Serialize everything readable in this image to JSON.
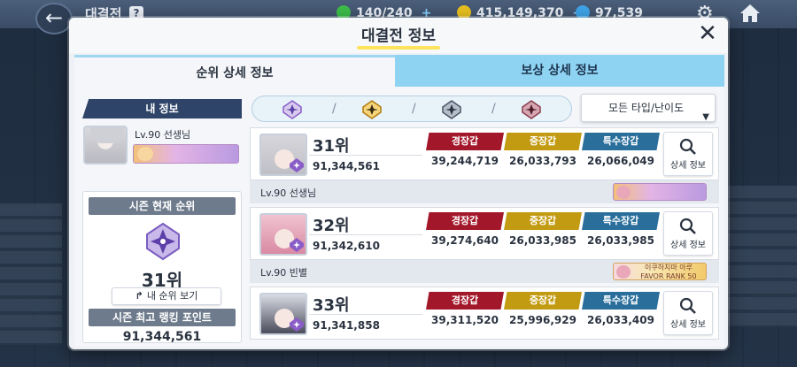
{
  "topbar": {
    "title": "대결전",
    "help": "?",
    "resources": [
      {
        "icon": "stamina-icon",
        "value": "140/240",
        "color": "#3dbd4a"
      },
      {
        "icon": "credit-icon",
        "value": "415,149,370",
        "color": "#e8c020"
      },
      {
        "icon": "pyroxene-icon",
        "value": "97,539",
        "color": "#3fa4e8"
      }
    ]
  },
  "modal": {
    "title": "대결전 정보",
    "tabs": [
      {
        "label": "순위 상세 정보",
        "active": true
      },
      {
        "label": "보상 상세 정보",
        "active": false
      }
    ]
  },
  "my_info": {
    "header": "내 정보",
    "level_name": "Lv.90 선생님",
    "season_rank_label": "시즌 현재 순위",
    "season_rank": "31위",
    "my_rank_button": "내 순위 보기",
    "best_points_label": "시즌 최고 랭킹 포인트",
    "best_points": "91,344,561"
  },
  "filters": {
    "types": [
      {
        "icon": "purple-emblem-icon",
        "color": "#8a5cc7"
      },
      {
        "icon": "gold-emblem-icon",
        "color": "#d8a01a"
      },
      {
        "icon": "gray-emblem-icon",
        "color": "#4a5564"
      },
      {
        "icon": "maroon-emblem-icon",
        "color": "#8a3a4a"
      }
    ],
    "dropdown_label": "모든 타입/난이도"
  },
  "stat_labels": {
    "light": "경장갑",
    "heavy": "중장갑",
    "special": "특수장갑"
  },
  "detail_label": "상세 정보",
  "rankings": [
    {
      "rank": "31위",
      "points": "91,344,561",
      "light": "39,244,719",
      "heavy": "26,033,793",
      "special": "26,066,049",
      "name": "Lv.90  선생님",
      "badge_text": ""
    },
    {
      "rank": "32위",
      "points": "91,342,610",
      "light": "39,274,640",
      "heavy": "26,033,985",
      "special": "26,033,985",
      "name": "Lv.90  빈별",
      "badge_text": "이쿠하치마 아루 FAVOR RANK 50"
    },
    {
      "rank": "33위",
      "points": "91,341,858",
      "light": "39,311,520",
      "heavy": "25,996,929",
      "special": "26,033,409",
      "name": "",
      "badge_text": ""
    }
  ]
}
